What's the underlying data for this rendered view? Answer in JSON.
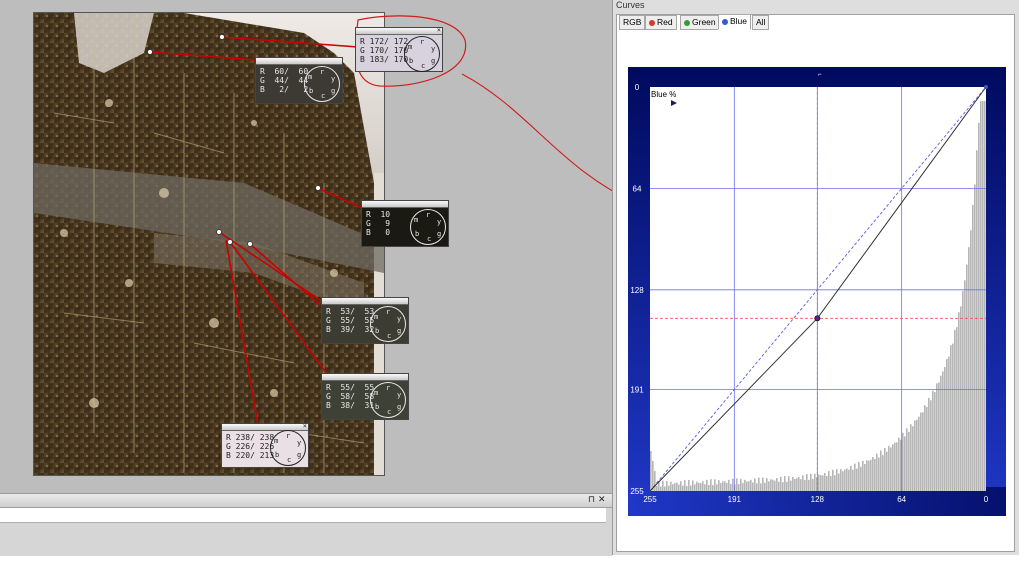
{
  "panel": {
    "title": "Curves",
    "tabs": [
      {
        "label": "RGB",
        "color": ""
      },
      {
        "label": "Red",
        "color": "#d23a2a"
      },
      {
        "label": "Green",
        "color": "#2e9e2e"
      },
      {
        "label": "Blue",
        "color": "#2c5ed1"
      },
      {
        "label": "All",
        "color": ""
      }
    ],
    "active_tab": "Blue"
  },
  "curve_graph": {
    "channel_label": "Blue %",
    "y_ticks": [
      "0",
      "64",
      "128",
      "191",
      "255"
    ],
    "x_ticks": [
      "255",
      "191",
      "128",
      "64",
      "0"
    ],
    "control_point": {
      "input": 128,
      "output": 146
    },
    "colors": {
      "border": "#06108f",
      "grid": "#6f6ff0",
      "curve": "#333333",
      "diagonal": "#5a5aee",
      "guide": "#ff4d4d",
      "histogram": "#b5b5b5"
    }
  },
  "pickers": [
    {
      "id": "p1",
      "r": "R 172/ 172",
      "g": "G 170/ 170",
      "b": "B 183/ 170",
      "bg": "#d8d2de",
      "fg": "#222222"
    },
    {
      "id": "p2",
      "r": "R  60/  60",
      "g": "G  44/  44",
      "b": "B   2/   2",
      "bg": "#3d3a33",
      "fg": "#e8e8e8"
    },
    {
      "id": "p3",
      "r": "R  10",
      "g": "G   9",
      "b": "B   0",
      "bg": "#1a1a12",
      "fg": "#e8e8e8"
    },
    {
      "id": "p4",
      "r": "R  53/  53",
      "g": "G  55/  55",
      "b": "B  39/  32",
      "bg": "#3c3c33",
      "fg": "#e8e8e8"
    },
    {
      "id": "p5",
      "r": "R  55/  55",
      "g": "G  58/  58",
      "b": "B  38/  31",
      "bg": "#3e4136",
      "fg": "#e8e8e8"
    },
    {
      "id": "p6",
      "r": "R 238/ 238",
      "g": "G 226/ 226",
      "b": "B 220/ 213",
      "bg": "#e9dfe4",
      "fg": "#222222"
    }
  ],
  "wheel_letters": {
    "m": "m",
    "r": "r",
    "y": "y",
    "g": "g",
    "c": "c",
    "b": "b"
  },
  "dock": {
    "pin": "⊓",
    "close": "✕"
  }
}
